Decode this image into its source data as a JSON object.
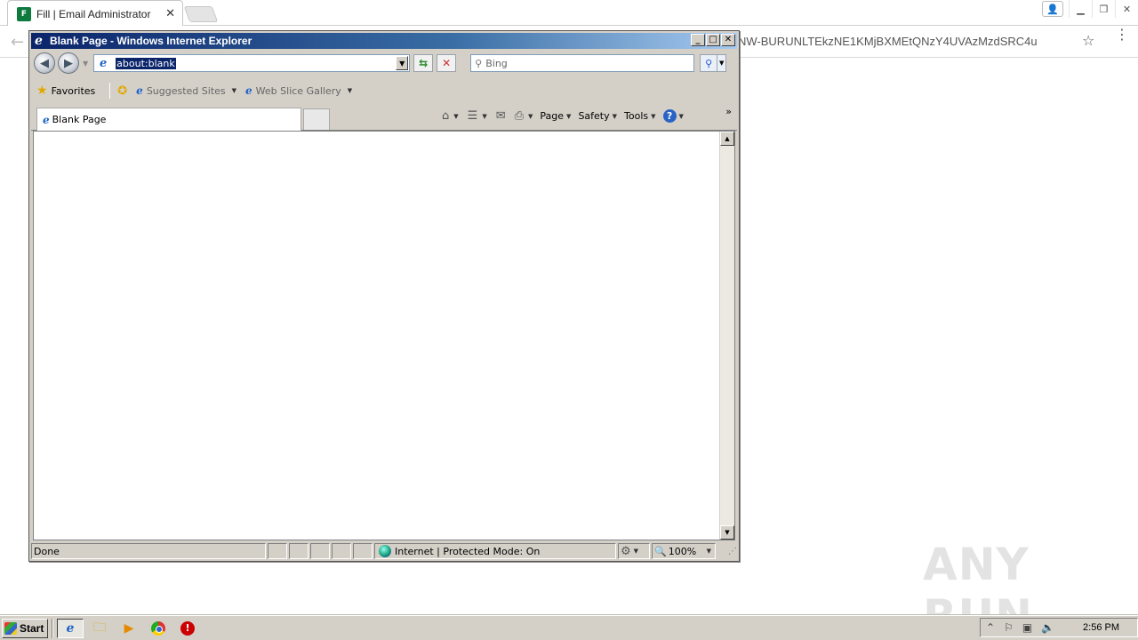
{
  "chrome": {
    "tab_title": "Fill | Email Administrator",
    "tab_favicon_text": "F",
    "close_glyph": "✕",
    "omnibox_url_tail": "NW-BURUNLTEkzNE1KMjBXMEtQNzY4UVAzMzdSRC4u",
    "star_glyph": "☆"
  },
  "ie": {
    "window_title": "Blank Page - Windows Internet Explorer",
    "address": "about:blank",
    "search_placeholder": "Bing",
    "favorites_label": "Favorites",
    "suggested_sites": "Suggested Sites",
    "web_slice_gallery": "Web Slice Gallery",
    "tab_title": "Blank Page",
    "commands": {
      "page": "Page",
      "safety": "Safety",
      "tools": "Tools"
    },
    "status": {
      "text": "Done",
      "zone": "Internet | Protected Mode: On",
      "zoom": "100%"
    }
  },
  "watermark": "ANY RUN",
  "taskbar": {
    "start_label": "Start",
    "clock": "2:56 PM"
  },
  "icons": [
    "back-arrow-icon",
    "forward-arrow-icon",
    "refresh-icon",
    "stop-icon",
    "search-icon",
    "home-icon",
    "feeds-icon",
    "mail-icon",
    "print-icon",
    "help-icon",
    "globe-icon",
    "zoom-icon",
    "gear-icon"
  ]
}
